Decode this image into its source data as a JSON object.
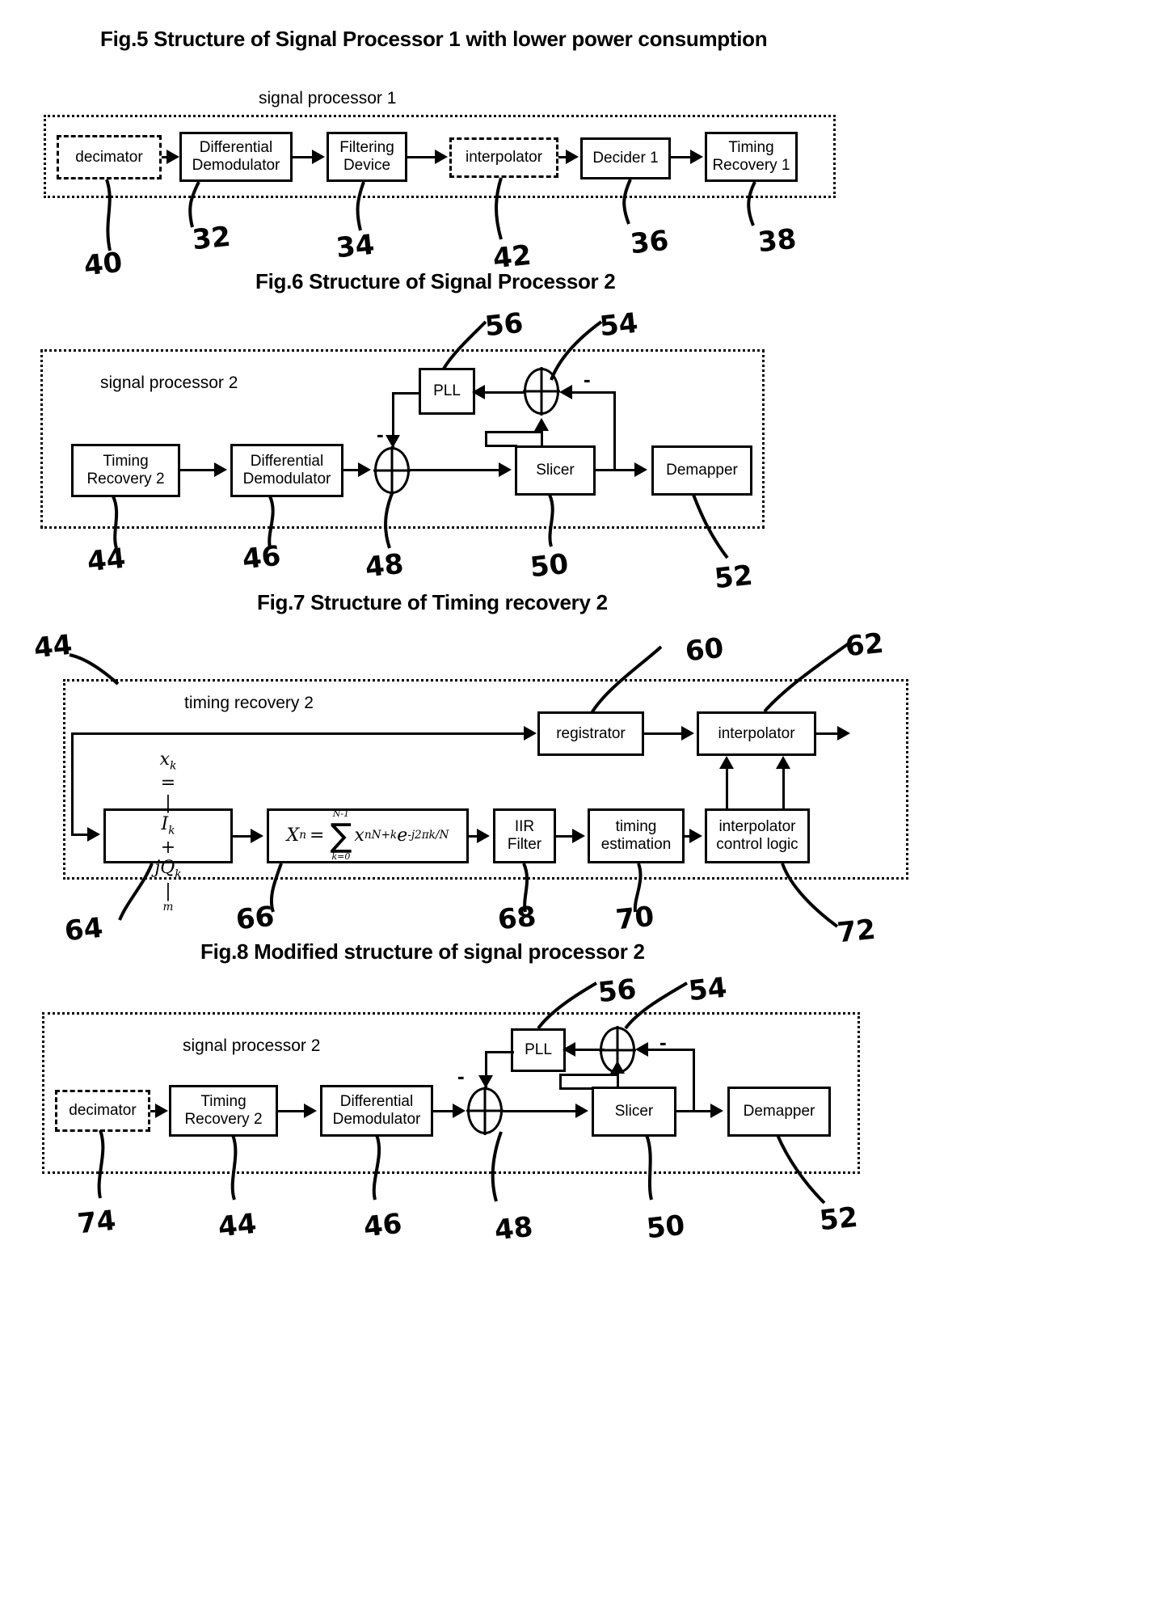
{
  "figures": [
    {
      "id": "fig5",
      "caption": "Fig.5 Structure of Signal Processor 1 with lower power consumption",
      "container_title": "signal processor 1",
      "blocks": [
        {
          "name": "decimator",
          "label": "decimator",
          "style": "dashed",
          "ref": "40"
        },
        {
          "name": "differential-demodulator",
          "label": "Differential\nDemodulator",
          "style": "solid",
          "ref": "32"
        },
        {
          "name": "filtering-device",
          "label": "Filtering\nDevice",
          "style": "solid",
          "ref": "34"
        },
        {
          "name": "interpolator",
          "label": "interpolator",
          "style": "dashed",
          "ref": "42"
        },
        {
          "name": "decider-1",
          "label": "Decider 1",
          "style": "solid",
          "ref": "36"
        },
        {
          "name": "timing-recovery-1",
          "label": "Timing\nRecovery 1",
          "style": "solid",
          "ref": "38"
        }
      ]
    },
    {
      "id": "fig6",
      "caption": "Fig.6 Structure of Signal Processor 2",
      "container_title": "signal processor 2",
      "blocks": [
        {
          "name": "timing-recovery-2",
          "label": "Timing\nRecovery 2",
          "style": "solid",
          "ref": "44"
        },
        {
          "name": "differential-demodulator",
          "label": "Differential\nDemodulator",
          "style": "solid",
          "ref": "46"
        },
        {
          "name": "summing-node-48",
          "label": "",
          "style": "sum",
          "ref": "48"
        },
        {
          "name": "slicer",
          "label": "Slicer",
          "style": "solid",
          "ref": "50"
        },
        {
          "name": "demapper",
          "label": "Demapper",
          "style": "solid",
          "ref": "52"
        },
        {
          "name": "pll",
          "label": "PLL",
          "style": "solid",
          "ref": "56"
        },
        {
          "name": "summing-node-54",
          "label": "",
          "style": "sum",
          "ref": "54"
        }
      ],
      "minus_signs": [
        "-",
        "-"
      ]
    },
    {
      "id": "fig7",
      "caption": "Fig.7 Structure of Timing recovery 2",
      "container_title": "timing recovery 2",
      "container_ref": "44",
      "blocks": [
        {
          "name": "magnitude-formula",
          "label": "formula-xk",
          "style": "solid",
          "ref": "64"
        },
        {
          "name": "dft-formula",
          "label": "formula-Xn",
          "style": "solid",
          "ref": "66"
        },
        {
          "name": "iir-filter",
          "label": "IIR\nFilter",
          "style": "solid",
          "ref": "68"
        },
        {
          "name": "timing-estimation",
          "label": "timing\nestimation",
          "style": "solid",
          "ref": "70"
        },
        {
          "name": "interpolator-control-logic",
          "label": "interpolator\ncontrol logic",
          "style": "solid",
          "ref": "72"
        },
        {
          "name": "registrator",
          "label": "registrator",
          "style": "solid",
          "ref": "60"
        },
        {
          "name": "interpolator",
          "label": "interpolator",
          "style": "solid",
          "ref": "62"
        }
      ],
      "formulas": {
        "magnitude": {
          "lhs": "x",
          "lhs_sub": "k",
          "rhs": "|I",
          "rhs_sub": "k",
          "plus": "+ jQ",
          "q_sub": "k",
          "bar_sup": "m"
        },
        "dft": {
          "lhs": "X",
          "lhs_sub": "n",
          "upper": "N-1",
          "lower": "k=0",
          "term": "x",
          "term_sub": "nN+k",
          "exp": "e",
          "exp_sup": "-j2πk/N"
        }
      }
    },
    {
      "id": "fig8",
      "caption": "Fig.8 Modified structure of signal processor 2",
      "container_title": "signal processor 2",
      "blocks": [
        {
          "name": "decimator",
          "label": "decimator",
          "style": "dashed",
          "ref": "74"
        },
        {
          "name": "timing-recovery-2",
          "label": "Timing\nRecovery 2",
          "style": "solid",
          "ref": "44"
        },
        {
          "name": "differential-demodulator",
          "label": "Differential\nDemodulator",
          "style": "solid",
          "ref": "46"
        },
        {
          "name": "summing-node-48",
          "label": "",
          "style": "sum",
          "ref": "48"
        },
        {
          "name": "slicer",
          "label": "Slicer",
          "style": "solid",
          "ref": "50"
        },
        {
          "name": "demapper",
          "label": "Demapper",
          "style": "solid",
          "ref": "52"
        },
        {
          "name": "pll",
          "label": "PLL",
          "style": "solid",
          "ref": "56"
        },
        {
          "name": "summing-node-54",
          "label": "",
          "style": "sum",
          "ref": "54"
        }
      ],
      "minus_signs": [
        "-",
        "-"
      ]
    }
  ],
  "fig5": {
    "caption": "Fig.5 Structure of Signal Processor 1 with lower power consumption",
    "container_title": "signal processor 1",
    "b_decimator": "decimator",
    "b_diffdemod_1": "Differential",
    "b_diffdemod_2": "Demodulator",
    "b_filtering_1": "Filtering",
    "b_filtering_2": "Device",
    "b_interpolator": "interpolator",
    "b_decider": "Decider 1",
    "b_timingrec_1": "Timing",
    "b_timingrec_2": "Recovery 1",
    "r40": "40",
    "r32": "32",
    "r34": "34",
    "r42": "42",
    "r36": "36",
    "r38": "38"
  },
  "fig6": {
    "caption": "Fig.6 Structure of Signal Processor 2",
    "container_title": "signal processor 2",
    "b_pll": "PLL",
    "b_timingrec_1": "Timing",
    "b_timingrec_2": "Recovery 2",
    "b_diffdemod_1": "Differential",
    "b_diffdemod_2": "Demodulator",
    "b_slicer": "Slicer",
    "b_demapper": "Demapper",
    "minus_a": "-",
    "minus_b": "-",
    "r56": "56",
    "r54": "54",
    "r44": "44",
    "r46": "46",
    "r48": "48",
    "r50": "50",
    "r52": "52"
  },
  "fig7": {
    "caption": "Fig.7 Structure of Timing recovery 2",
    "container_title": "timing recovery 2",
    "b_registrator": "registrator",
    "b_interpolator": "interpolator",
    "b_iir_1": "IIR",
    "b_iir_2": "Filter",
    "b_timingest_1": "timing",
    "b_timingest_2": "estimation",
    "b_ctrl_1": "interpolator",
    "b_ctrl_2": "control logic",
    "f1_x": "x",
    "f1_xsub": "k",
    "f1_eq": "=",
    "f1_bar1": "|",
    "f1_I": "I",
    "f1_Isub": "k",
    "f1_plus": "+",
    "f1_j": "j",
    "f1_Q": "Q",
    "f1_Qsub": "k",
    "f1_bar2": "|",
    "f1_m": "m",
    "f2_X": "X",
    "f2_Xsub": "n",
    "f2_eq": "=",
    "f2_upper": "N-1",
    "f2_lower": "k=0",
    "f2_x": "x",
    "f2_xsub": "nN+k",
    "f2_e": "e",
    "f2_esup": "-j2πk/N",
    "r44": "44",
    "r60": "60",
    "r62": "62",
    "r64": "64",
    "r66": "66",
    "r68": "68",
    "r70": "70",
    "r72": "72"
  },
  "fig8": {
    "caption": "Fig.8 Modified structure of signal processor 2",
    "container_title": "signal processor 2",
    "b_pll": "PLL",
    "b_decimator": "decimator",
    "b_timingrec_1": "Timing",
    "b_timingrec_2": "Recovery 2",
    "b_diffdemod_1": "Differential",
    "b_diffdemod_2": "Demodulator",
    "b_slicer": "Slicer",
    "b_demapper": "Demapper",
    "minus_a": "-",
    "minus_b": "-",
    "r56": "56",
    "r54": "54",
    "r74": "74",
    "r44": "44",
    "r46": "46",
    "r48": "48",
    "r50": "50",
    "r52": "52"
  }
}
